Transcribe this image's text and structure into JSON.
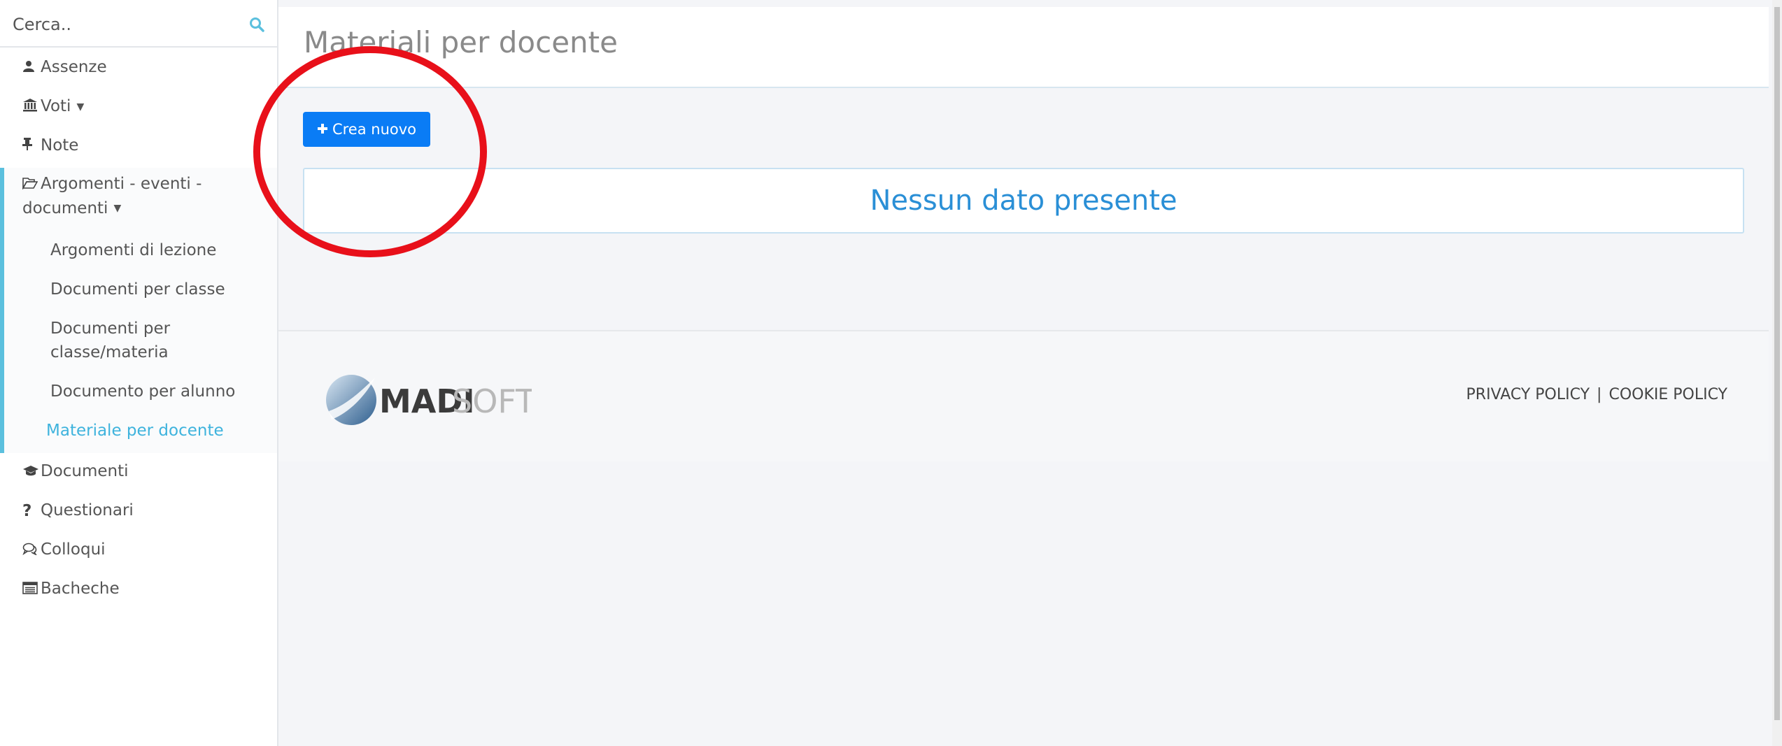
{
  "sidebar": {
    "search_placeholder": "Cerca..",
    "items": [
      {
        "label": "Assenze",
        "icon": "user-icon"
      },
      {
        "label": "Voti",
        "icon": "bank-icon"
      },
      {
        "label": "Note",
        "icon": "pin-icon"
      },
      {
        "label": "Argomenti - eventi -",
        "label2": "documenti",
        "icon": "folder-open-icon"
      },
      {
        "label": "Documenti",
        "icon": "graduation-cap-icon"
      },
      {
        "label": "Questionari",
        "icon": "question-icon"
      },
      {
        "label": "Colloqui",
        "icon": "comments-icon"
      },
      {
        "label": "Bacheche",
        "icon": "list-alt-icon"
      }
    ],
    "subitems": [
      {
        "label": "Argomenti di lezione"
      },
      {
        "label": "Documenti per classe"
      },
      {
        "label": "Documenti per",
        "label2": "classe/materia"
      },
      {
        "label": "Documento per alunno"
      },
      {
        "label": "Materiale per docente",
        "active": true
      }
    ]
  },
  "main": {
    "title": "Materiali per docente",
    "create_button": "Crea nuovo",
    "empty_message": "Nessun dato presente"
  },
  "footer": {
    "logo_bold": "MADI",
    "logo_light": "SOFT",
    "links": [
      "PRIVACY POLICY",
      "COOKIE POLICY"
    ],
    "separator": "|"
  },
  "colors": {
    "accent": "#3eb3dd",
    "button": "#0a7cf5",
    "annotation": "#e8101a"
  }
}
